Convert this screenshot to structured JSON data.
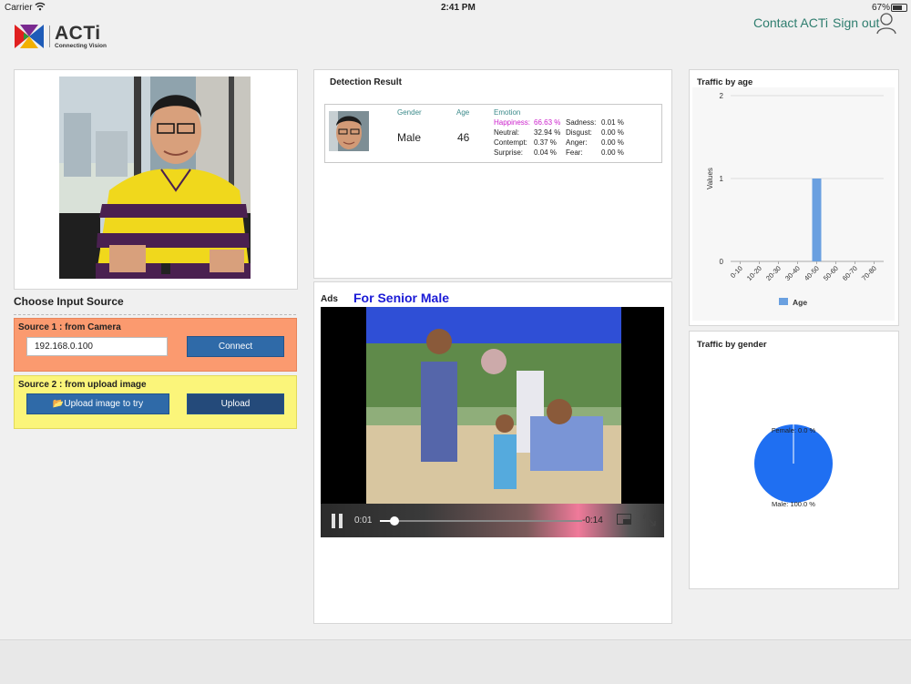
{
  "status_bar": {
    "carrier": "Carrier",
    "time": "2:41 PM",
    "battery": "67%"
  },
  "header": {
    "brand": "ACTi",
    "tagline": "Connecting Vision",
    "contact": "Contact ACTi",
    "signout": "Sign out"
  },
  "input": {
    "title": "Choose Input Source",
    "source1": {
      "title": "Source 1 : from Camera",
      "ip": "192.168.0.100",
      "connect": "Connect"
    },
    "source2": {
      "title": "Source 2 : from upload image",
      "try": "Upload image to try",
      "upload": "Upload"
    }
  },
  "detection": {
    "title": "Detection Result",
    "gender_label": "Gender",
    "gender": "Male",
    "age_label": "Age",
    "age": "46",
    "emotion_label": "Emotion",
    "emotions_left": [
      {
        "name": "Happiness:",
        "value": "66.63 %"
      },
      {
        "name": "Neutral:",
        "value": "32.94 %"
      },
      {
        "name": "Contempt:",
        "value": "0.37 %"
      },
      {
        "name": "Surprise:",
        "value": "0.04 %"
      }
    ],
    "emotions_right": [
      {
        "name": "Sadness:",
        "value": "0.01 %"
      },
      {
        "name": "Disgust:",
        "value": "0.00 %"
      },
      {
        "name": "Anger:",
        "value": "0.00 %"
      },
      {
        "name": "Fear:",
        "value": "0.00 %"
      }
    ],
    "highlight_color": "#cc22cc"
  },
  "ads": {
    "label": "Ads",
    "title": "For Senior Male",
    "elapsed": "0:01",
    "remaining": "-0:14",
    "progress": 0.07
  },
  "age_chart": {
    "title": "Traffic by age",
    "chart_data": {
      "type": "bar",
      "categories": [
        "0-10",
        "10-20",
        "20-30",
        "30-40",
        "40-50",
        "50-60",
        "60-70",
        "70-80"
      ],
      "series": [
        {
          "name": "Age",
          "values": [
            0,
            0,
            0,
            0,
            1,
            0,
            0,
            0
          ]
        }
      ],
      "ylabel": "Values",
      "ylim": [
        0,
        2
      ],
      "yticks": [
        "0",
        "1",
        "2"
      ],
      "grid": true,
      "legend": "bottom",
      "color": "#6aa0e0"
    }
  },
  "gender_chart": {
    "title": "Traffic by gender",
    "chart_data": {
      "type": "pie",
      "labels": [
        "Female: 0.0 %",
        "Male: 100.0 %"
      ],
      "values": [
        0,
        100
      ],
      "color": "#1f6ff2"
    }
  }
}
